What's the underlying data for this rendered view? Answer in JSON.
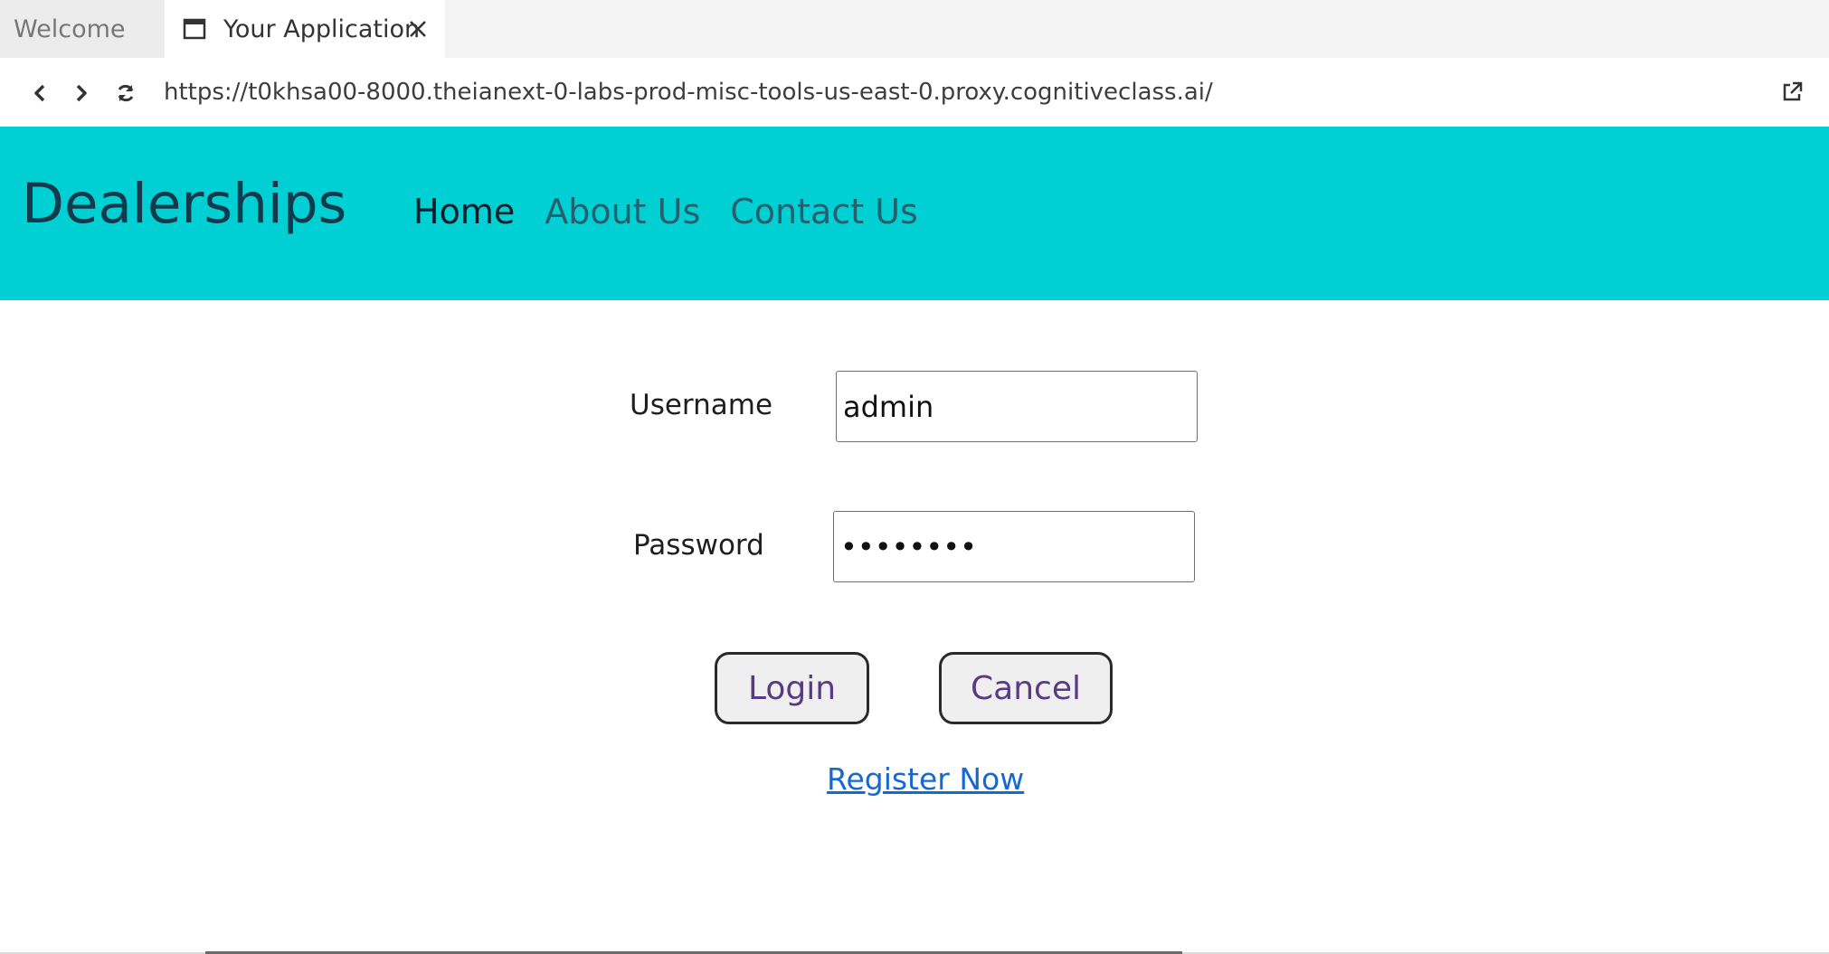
{
  "tabs": [
    {
      "label": "Welcome",
      "icon": "",
      "active": false
    },
    {
      "label": "Your Application",
      "icon": "browser-window-icon",
      "active": true
    }
  ],
  "browser": {
    "url": "https://t0khsa00-8000.theianext-0-labs-prod-misc-tools-us-east-0.proxy.cognitiveclass.ai/",
    "icons": [
      "back-icon",
      "forward-icon",
      "refresh-icon",
      "open-external-icon"
    ]
  },
  "site": {
    "brand": "Dealerships",
    "nav": [
      {
        "label": "Home",
        "active": true
      },
      {
        "label": "About Us",
        "active": false
      },
      {
        "label": "Contact Us",
        "active": false
      }
    ],
    "header_color": "#00cfd3"
  },
  "login": {
    "username_label": "Username",
    "username_value": "admin",
    "password_label": "Password",
    "password_value": "password",
    "login_button": "Login",
    "cancel_button": "Cancel",
    "register_link": "Register Now"
  }
}
